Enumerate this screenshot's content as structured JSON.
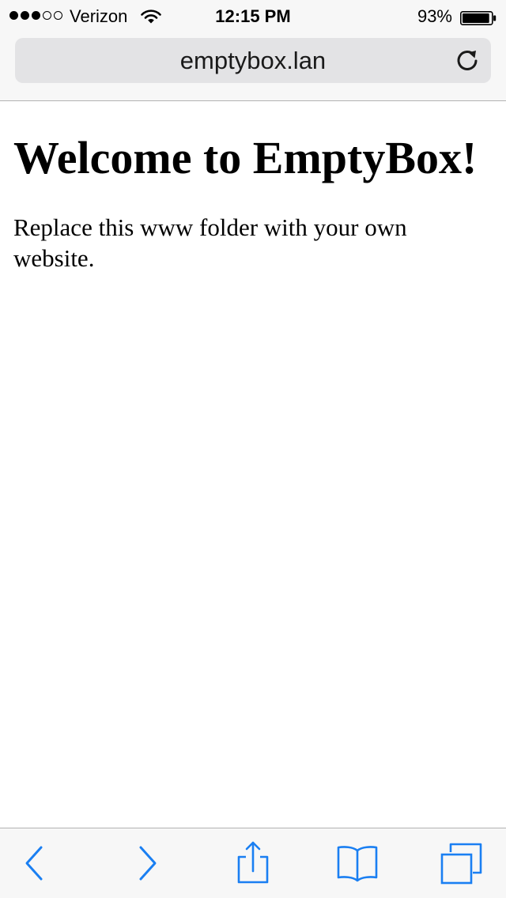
{
  "status_bar": {
    "carrier": "Verizon",
    "time": "12:15 PM",
    "battery_percent": "93%",
    "signal_bars_filled": 3,
    "signal_bars_total": 5,
    "battery_level": 0.93
  },
  "browser": {
    "url": "emptybox.lan",
    "reload_icon": "reload-icon"
  },
  "page": {
    "heading": "Welcome to EmptyBox!",
    "body": "Replace this www folder with your own website."
  },
  "toolbar": {
    "icons": [
      "back-icon",
      "forward-icon",
      "share-icon",
      "bookmarks-icon",
      "tabs-icon"
    ]
  },
  "colors": {
    "accent": "#1a7ff2",
    "chrome_bg": "#f7f7f7",
    "url_field_bg": "#e3e3e5"
  }
}
